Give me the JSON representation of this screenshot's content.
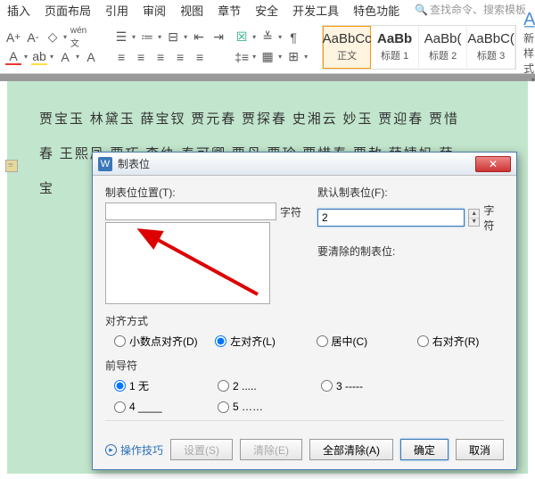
{
  "ribbon": {
    "tabs": [
      "插入",
      "页面布局",
      "引用",
      "审阅",
      "视图",
      "章节",
      "安全",
      "开发工具",
      "特色功能"
    ],
    "search_placeholder": "查找命令、搜索模板"
  },
  "styles": {
    "items": [
      {
        "preview": "AaBbCc",
        "label": "正文",
        "bold": false,
        "selected": true
      },
      {
        "preview": "AaBb",
        "label": "标题 1",
        "bold": true,
        "selected": false
      },
      {
        "preview": "AaBb(",
        "label": "标题 2",
        "bold": false,
        "selected": false
      },
      {
        "preview": "AaBbC(",
        "label": "标题 3",
        "bold": false,
        "selected": false
      }
    ],
    "new_style": "新样式"
  },
  "document": {
    "line1": "贾宝玉  林黛玉  薛宝钗  贾元春  贾探春  史湘云  妙玉  贾迎春  贾惜",
    "line2": "春  王熙凤  贾巧  李纨  秦可卿  贾母  贾珍  贾惜春  贾赦  薛姨妈  薛",
    "line3": "宝"
  },
  "dialog": {
    "title": "制表位",
    "tab_pos_label": "制表位位置(T):",
    "default_tab_label": "默认制表位(F):",
    "default_tab_value": "2",
    "unit": "字符",
    "clear_label": "要清除的制表位:",
    "align_label": "对齐方式",
    "align_options": [
      {
        "key": "decimal",
        "label": "小数点对齐(D)"
      },
      {
        "key": "left",
        "label": "左对齐(L)"
      },
      {
        "key": "center",
        "label": "居中(C)"
      },
      {
        "key": "right",
        "label": "右对齐(R)"
      }
    ],
    "align_selected": "left",
    "leader_label": "前导符",
    "leader_options": [
      {
        "key": "1",
        "label": "1 无"
      },
      {
        "key": "2",
        "label": "2 ....."
      },
      {
        "key": "3",
        "label": "3 -----"
      },
      {
        "key": "4",
        "label": "4 ____"
      },
      {
        "key": "5",
        "label": "5 ……"
      }
    ],
    "leader_selected": "1",
    "tips": "操作技巧",
    "btn_set": "设置(S)",
    "btn_clear": "清除(E)",
    "btn_clear_all": "全部清除(A)",
    "btn_ok": "确定",
    "btn_cancel": "取消"
  }
}
